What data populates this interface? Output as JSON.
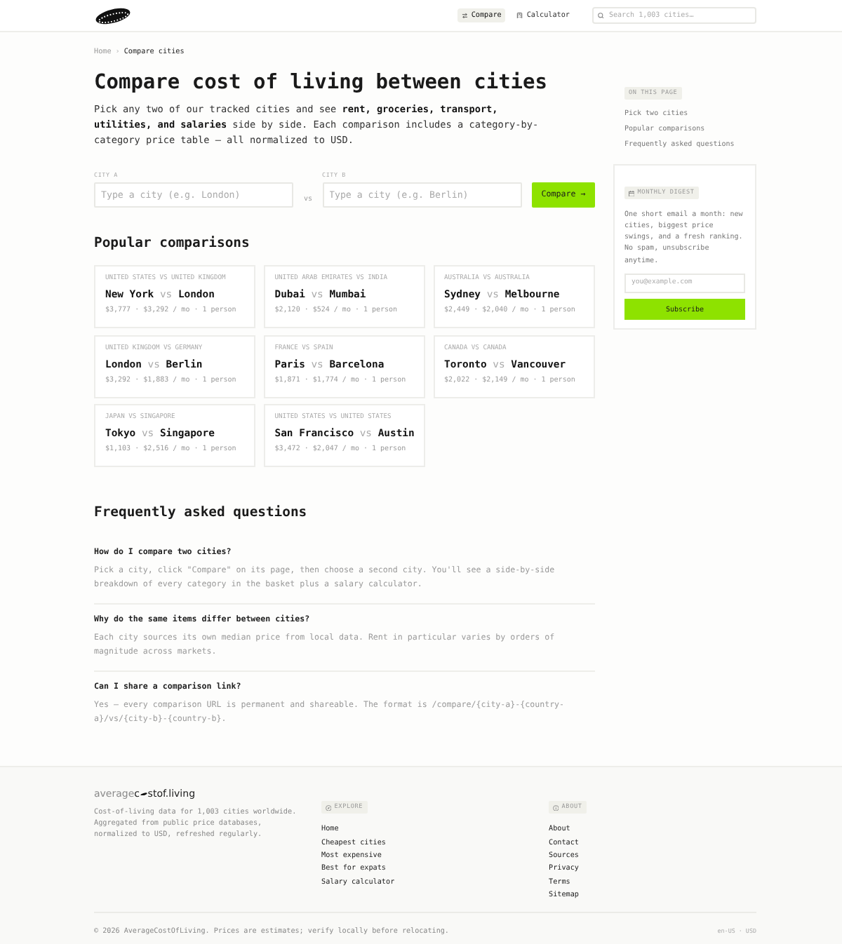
{
  "header": {
    "nav": [
      {
        "label": "Compare",
        "selected": true
      },
      {
        "label": "Calculator",
        "selected": false
      }
    ],
    "search": {
      "placeholder": "Search 1,003 cities…"
    }
  },
  "breadcrumb": {
    "link": "Home",
    "separator": "›",
    "current": "Compare cities"
  },
  "title": "Compare cost of living between cities",
  "intro": "Pick any two of our tracked cities and see **rent, groceries, transport, utilities, and salaries** side by side. Each comparison includes a category-by-category price table — all normalized to USD.",
  "compare_form": {
    "city_a": {
      "label": "CITY A",
      "placeholder": "Type a city (e.g. London)"
    },
    "separator": "vs",
    "city_b": {
      "label": "CITY B",
      "placeholder": "Type a city (e.g. Berlin)"
    },
    "button": "Compare →"
  },
  "popular": {
    "heading": "Popular comparisons",
    "cards": [
      {
        "countries": "UNITED STATES VS UNITED KINGDOM",
        "city_a": "New York",
        "vs": "vs",
        "city_b": "London",
        "prices": "$3,777 · $3,292 / mo · 1 person"
      },
      {
        "countries": "UNITED ARAB EMIRATES VS INDIA",
        "city_a": "Dubai",
        "vs": "vs",
        "city_b": "Mumbai",
        "prices": "$2,120 · $524 / mo · 1 person"
      },
      {
        "countries": "AUSTRALIA VS AUSTRALIA",
        "city_a": "Sydney",
        "vs": "vs",
        "city_b": "Melbourne",
        "prices": "$2,449 · $2,040 / mo · 1 person"
      },
      {
        "countries": "UNITED KINGDOM VS GERMANY",
        "city_a": "London",
        "vs": "vs",
        "city_b": "Berlin",
        "prices": "$3,292 · $1,883 / mo · 1 person"
      },
      {
        "countries": "FRANCE VS SPAIN",
        "city_a": "Paris",
        "vs": "vs",
        "city_b": "Barcelona",
        "prices": "$1,871 · $1,774 / mo · 1 person"
      },
      {
        "countries": "CANADA VS CANADA",
        "city_a": "Toronto",
        "vs": "vs",
        "city_b": "Vancouver",
        "prices": "$2,022 · $2,149 / mo · 1 person"
      },
      {
        "countries": "JAPAN VS SINGAPORE",
        "city_a": "Tokyo",
        "vs": "vs",
        "city_b": "Singapore",
        "prices": "$1,103 · $2,516 / mo · 1 person"
      },
      {
        "countries": "UNITED STATES VS UNITED STATES",
        "city_a": "San Francisco",
        "vs": "vs",
        "city_b": "Austin",
        "prices": "$3,472 · $2,047 / mo · 1 person"
      }
    ]
  },
  "faq": {
    "heading": "Frequently asked questions",
    "items": [
      {
        "question": "How do I compare two cities?",
        "answer": "Pick a city, click \"Compare\" on its page, then choose a second city. You'll see a side-by-side breakdown of every category in the basket plus a salary calculator."
      },
      {
        "question": "Why do the same items differ between cities?",
        "answer": "Each city sources its own median price from local data. Rent in particular varies by orders of magnitude across markets."
      },
      {
        "question": "Can I share a comparison link?",
        "answer": "Yes — every comparison URL is permanent and shareable. The format is /compare/{city-a}-{country-a}/vs/{city-b}-{country-b}."
      }
    ]
  },
  "sidebar": {
    "on_this_page": {
      "badge": "ON THIS PAGE",
      "links": [
        "Pick two cities",
        "Popular comparisons",
        "Frequently asked questions"
      ]
    },
    "digest": {
      "badge": "MONTHLY DIGEST",
      "text": "One short email a month: new cities, biggest price swings, and a fresh ranking. No spam, unsubscribe anytime.",
      "email": {
        "placeholder": "you@example.com"
      },
      "button": "Subscribe"
    }
  },
  "footer": {
    "logo": {
      "muted": "average",
      "strong_start": "c",
      "strong_end": "stof.living"
    },
    "description": "Cost-of-living data for 1,003 cities worldwide. Aggregated from public price databases, normalized to USD, refreshed regularly.",
    "columns": [
      {
        "badge": "EXPLORE",
        "links": [
          "Home",
          "Cheapest cities",
          "Most expensive",
          "Best for expats",
          "Salary calculator"
        ]
      },
      {
        "badge": "ABOUT",
        "links": [
          "About",
          "Contact",
          "Sources",
          "Privacy",
          "Terms",
          "Sitemap"
        ]
      }
    ],
    "copyright": "© 2026 AverageCostOfLiving. Prices are estimates; verify locally before relocating.",
    "locale": "en-US · USD"
  }
}
